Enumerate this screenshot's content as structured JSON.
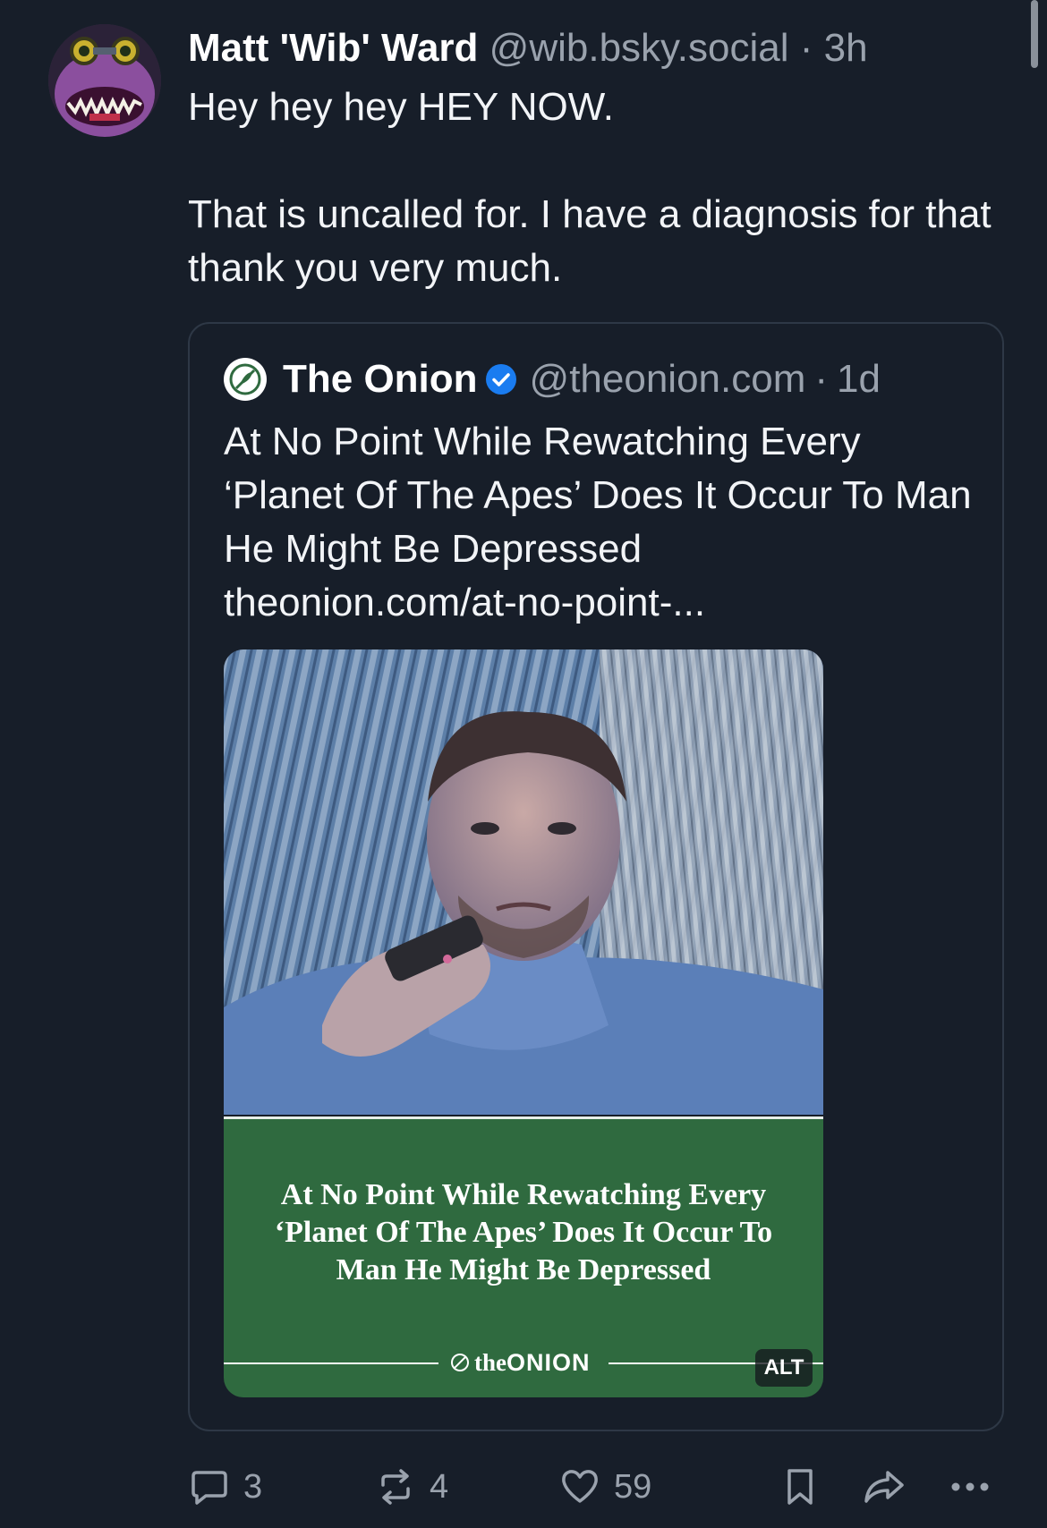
{
  "post": {
    "display_name": "Matt 'Wib' Ward",
    "handle": "@wib.bsky.social",
    "separator": "·",
    "time": "3h",
    "text_line1": "Hey hey hey HEY NOW.",
    "text_line2": "That is uncalled for. I have a diagnosis for that thank you very much."
  },
  "quote": {
    "display_name": "The Onion",
    "handle": "@theonion.com",
    "separator": "·",
    "time": "1d",
    "text": "At No Point While Rewatching Every ‘Planet Of The Apes’ Does It Occur To Man He Might Be Depressed",
    "link": "theonion.com/at-no-point-...",
    "image_headline": "At No Point While Rewatching Every ‘Planet Of The Apes’ Does It Occur To Man He Might Be Depressed",
    "logo_the": "the",
    "logo_onion": "ONION",
    "alt_label": "ALT"
  },
  "actions": {
    "replies": "3",
    "reposts": "4",
    "likes": "59"
  },
  "icons": [
    "reply-icon",
    "repost-icon",
    "like-icon",
    "bookmark-icon",
    "share-icon",
    "more-icon",
    "verified-icon",
    "onion-logo-icon"
  ],
  "colors": {
    "background": "#171e29",
    "muted_text": "#9aa2ad",
    "card_border": "#2e3846",
    "onion_green": "#2f6a3f",
    "verified_blue": "#1a7cf0"
  }
}
